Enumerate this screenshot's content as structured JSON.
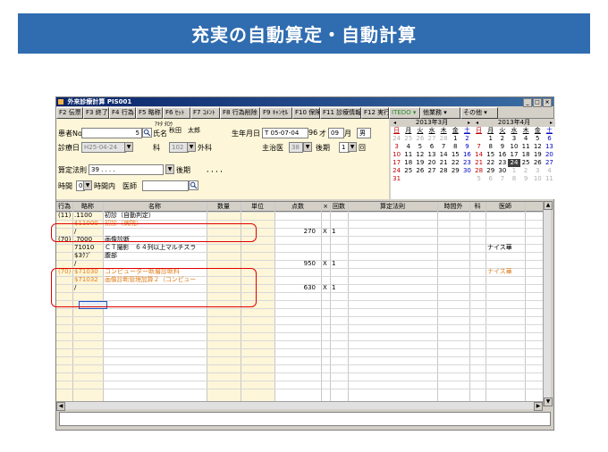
{
  "banner": {
    "title": "充実の自動算定・自動計算"
  },
  "window": {
    "title": "外来診療計算 PIS001",
    "controls": [
      "_",
      "□",
      "×"
    ]
  },
  "toolbar": [
    {
      "label": "F2 伝票",
      "w": 30
    },
    {
      "label": "F3 終了",
      "w": 29
    },
    {
      "label": "F4 行為",
      "w": 30
    },
    {
      "label": "F5 略称",
      "w": 30
    },
    {
      "label": "F6 ｾｯﾄ",
      "w": 31
    },
    {
      "label": "F7 ｺﾒﾝﾄ",
      "w": 33
    },
    {
      "label": "F8 行為削除",
      "w": 45
    },
    {
      "label": "F9 ｷｬﾝｾﾙ",
      "w": 36
    },
    {
      "label": "F10 保険",
      "w": 31
    },
    {
      "label": "F11 診療情報",
      "w": 46
    },
    {
      "label": "F12 実行",
      "w": 31
    },
    {
      "label": "ITEDO ▾",
      "w": 35,
      "green": true
    },
    {
      "label": "他業務 ▾",
      "w": 45
    },
    {
      "label": "その他 ▾",
      "w": 42
    }
  ],
  "form": {
    "kana": "ｱｷﾀ ﾀﾛｳ",
    "patient_no_label": "患者No",
    "patient_no": "5",
    "name_label": "氏名",
    "name": "秋田　太郎",
    "birth_label": "生年月日",
    "birth": "T 05-07-04",
    "age": "96",
    "age_unit": "才",
    "month": "09",
    "month_unit": "月",
    "sex": "男",
    "visit_label": "診療日",
    "visit_date": "H25-04-24",
    "dept_label": "科",
    "dept_code": "102",
    "dept_name": "外科",
    "rule_label": "主治医",
    "rule_code": "38",
    "rule_name": "後期",
    "count": "1",
    "count_unit": "回",
    "santei_label": "算定法則",
    "santei_value": "39 .  .  .  .",
    "kouki": "後期",
    "dots": ",   ,   ,   ,",
    "time_label": "時間",
    "time_value": "0",
    "time_text": "時間内",
    "doctor_label": "医師"
  },
  "calendars": [
    {
      "title": "2013年3月",
      "dow": [
        "日",
        "月",
        "火",
        "水",
        "木",
        "金",
        "土"
      ],
      "weeks": [
        [
          "24",
          "25",
          "26",
          "27",
          "28",
          "1",
          "2"
        ],
        [
          "3",
          "4",
          "5",
          "6",
          "7",
          "8",
          "9"
        ],
        [
          "10",
          "11",
          "12",
          "13",
          "14",
          "15",
          "16"
        ],
        [
          "17",
          "18",
          "19",
          "20",
          "21",
          "22",
          "23"
        ],
        [
          "24",
          "25",
          "26",
          "27",
          "28",
          "29",
          "30"
        ],
        [
          "31",
          "",
          "",
          "",
          "",
          "",
          ""
        ]
      ],
      "other_first_week": 5
    },
    {
      "title": "2013年4月",
      "dow": [
        "日",
        "月",
        "火",
        "水",
        "木",
        "金",
        "土"
      ],
      "weeks": [
        [
          "",
          "1",
          "2",
          "3",
          "4",
          "5",
          "6"
        ],
        [
          "7",
          "8",
          "9",
          "10",
          "11",
          "12",
          "13"
        ],
        [
          "14",
          "15",
          "16",
          "17",
          "18",
          "19",
          "20"
        ],
        [
          "21",
          "22",
          "23",
          "24",
          "25",
          "26",
          "27"
        ],
        [
          "28",
          "29",
          "30",
          "1",
          "2",
          "3",
          "4"
        ],
        [
          "5",
          "6",
          "7",
          "8",
          "9",
          "10",
          "11"
        ]
      ],
      "today": "24"
    }
  ],
  "grid": {
    "headers": [
      "行為",
      "略称",
      "名称",
      "数量",
      "単位",
      "点数",
      "×",
      "回数",
      "算定法則",
      "時間外",
      "科",
      "医師"
    ],
    "rows": [
      {
        "act": "(11)",
        "code": ".1100",
        "name": "初診（自動判定）",
        "color": "black"
      },
      {
        "act": "",
        "code": "$11000",
        "name": "初診（病院）",
        "color": "orange"
      },
      {
        "act": "",
        "code": "/",
        "name": "",
        "points": "270",
        "x": "X",
        "times": "1",
        "color": "black"
      },
      {
        "act": "(70)",
        "code": ".7000",
        "name": "画像診断",
        "color": "black"
      },
      {
        "act": "",
        "code": "71010",
        "name": "ＣＴ撮影　６４列以上マルチスラ",
        "doctor": "ナイス華",
        "color": "black"
      },
      {
        "act": "",
        "code": "$3ｸﾌﾞ",
        "name": "腹部",
        "color": "black"
      },
      {
        "act": "",
        "code": "/",
        "name": "",
        "points": "950",
        "x": "X",
        "times": "1",
        "color": "black"
      },
      {
        "act": "(70)",
        "code": "$71030",
        "name": "コンピューター断層診断料",
        "doctor": "ナイス華",
        "color": "orange"
      },
      {
        "act": "",
        "code": "$71032",
        "name": "画像診断管理加算２（コンピュー",
        "color": "orange"
      },
      {
        "act": "",
        "code": "/",
        "name": "",
        "points": "630",
        "x": "X",
        "times": "1",
        "color": "black"
      }
    ]
  },
  "colors": {
    "banner": "#2f6cb0",
    "highlight": "#e00000",
    "form_bg": "#fdf6d8",
    "orange_text": "#e08020"
  }
}
